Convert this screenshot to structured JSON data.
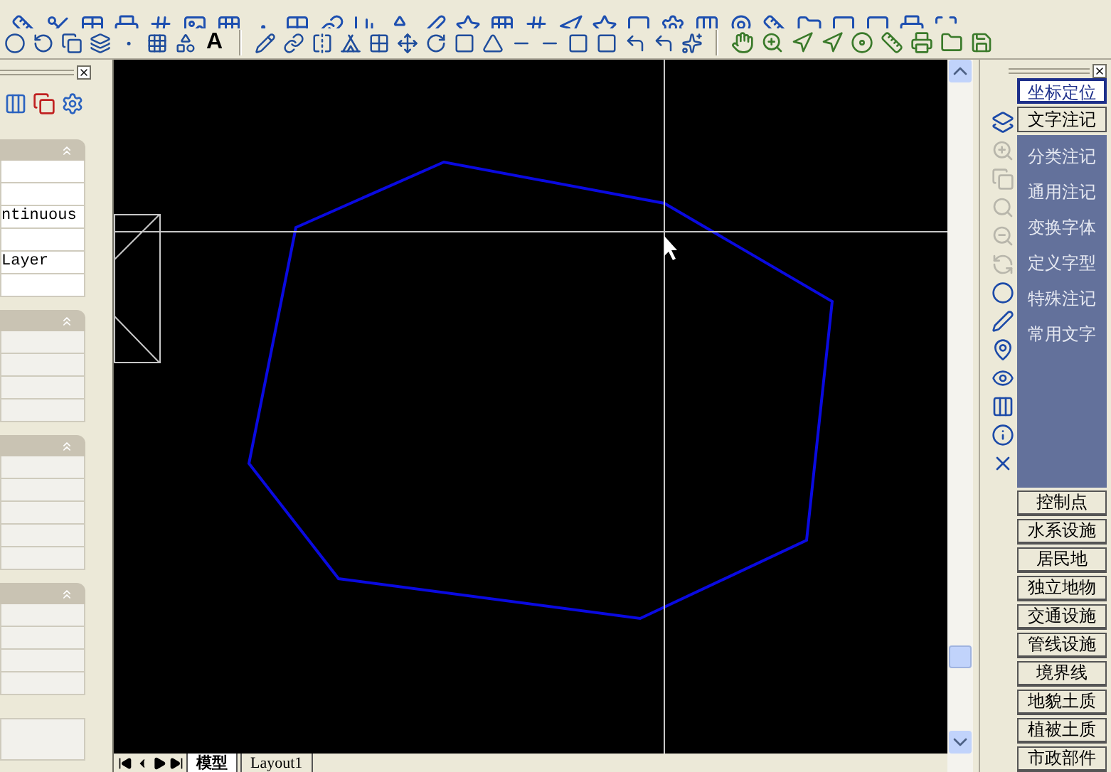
{
  "toolbar": {
    "text_tool": "A"
  },
  "left_panel": {
    "sections": [
      {
        "expanded": true,
        "rows": [
          "",
          "",
          "ntinuous",
          "",
          "Layer",
          ""
        ]
      },
      {
        "expanded": true,
        "rows": [
          "",
          "",
          "",
          ""
        ]
      },
      {
        "expanded": true,
        "rows": [
          "",
          "",
          "",
          "",
          ""
        ]
      },
      {
        "expanded": true,
        "rows": [
          "",
          "",
          "",
          ""
        ]
      }
    ]
  },
  "drawing_tabs": [
    {
      "label": "模型",
      "selected": true
    },
    {
      "label": "Layout1",
      "selected": false
    }
  ],
  "right_panel": {
    "top_buttons": [
      {
        "label": "坐标定位",
        "selected": true
      },
      {
        "label": "文字注记",
        "selected": false
      }
    ],
    "group_items": [
      "分类注记",
      "通用注记",
      "变换字体",
      "定义字型",
      "特殊注记",
      "常用文字"
    ],
    "side_tools": [
      {
        "disabled": false
      },
      {
        "disabled": true
      },
      {
        "disabled": true
      },
      {
        "disabled": true
      },
      {
        "disabled": true
      },
      {
        "disabled": true
      },
      {
        "disabled": false
      },
      {
        "disabled": false
      },
      {
        "disabled": false
      },
      {
        "disabled": false
      },
      {
        "disabled": false
      },
      {
        "disabled": false
      },
      {
        "disabled": false
      }
    ],
    "categories": [
      "控制点",
      "水系设施",
      "居民地",
      "独立地物",
      "交通设施",
      "管线设施",
      "境界线",
      "地貌土质",
      "植被土质",
      "市政部件"
    ]
  }
}
